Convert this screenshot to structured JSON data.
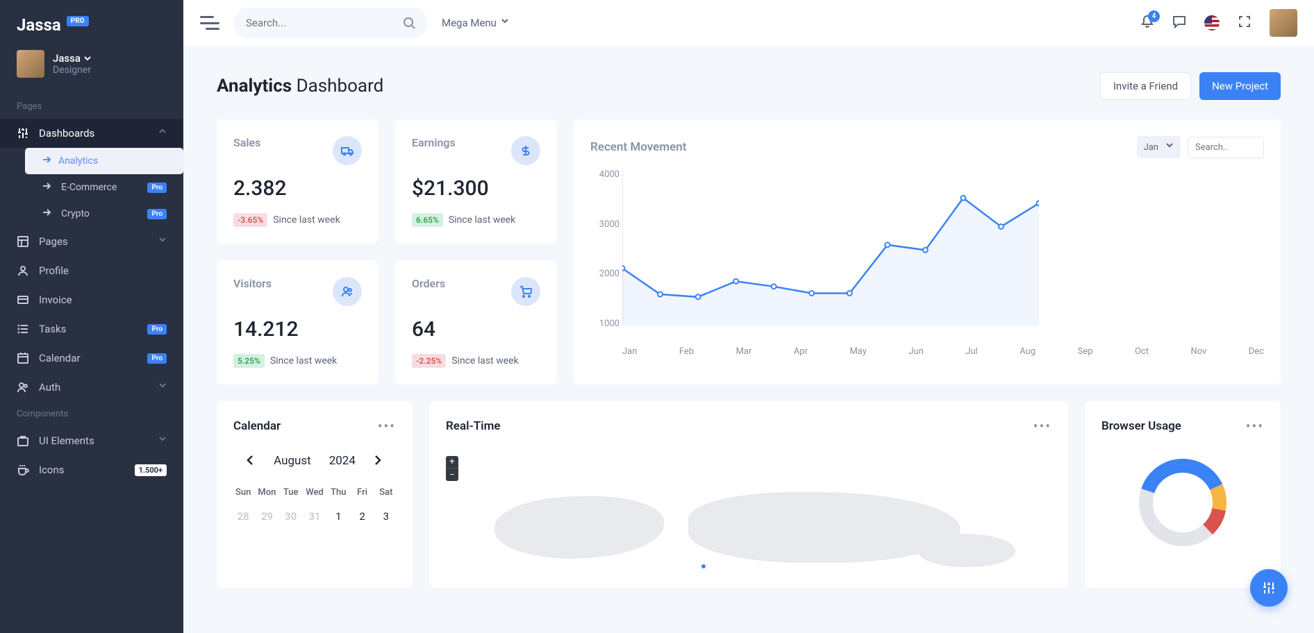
{
  "brand": {
    "name": "Jassa",
    "badge": "PRO"
  },
  "user": {
    "name": "Jassa",
    "role": "Designer"
  },
  "nav": {
    "heading1": "Pages",
    "heading2": "Components",
    "dashboards": "Dashboards",
    "analytics": "Analytics",
    "ecommerce": "E-Commerce",
    "crypto": "Crypto",
    "pages": "Pages",
    "profile": "Profile",
    "invoice": "Invoice",
    "tasks": "Tasks",
    "calendar": "Calendar",
    "auth": "Auth",
    "ui": "UI Elements",
    "icons": "Icons",
    "pro": "Pro",
    "icons_count": "1.500+"
  },
  "topbar": {
    "search_ph": "Search...",
    "mega": "Mega Menu",
    "notif": "4"
  },
  "page": {
    "title_bold": "Analytics",
    "title_rest": "Dashboard",
    "invite": "Invite a Friend",
    "new": "New Project"
  },
  "stats": {
    "since": "Since last week",
    "sales": {
      "label": "Sales",
      "value": "2.382",
      "pct": "-3.65%"
    },
    "earnings": {
      "label": "Earnings",
      "value": "$21.300",
      "pct": "6.65%"
    },
    "visitors": {
      "label": "Visitors",
      "value": "14.212",
      "pct": "5.25%"
    },
    "orders": {
      "label": "Orders",
      "value": "64",
      "pct": "-2.25%"
    }
  },
  "chart": {
    "title": "Recent Movement",
    "period": "Jan",
    "search_ph": "Search.."
  },
  "chart_data": {
    "type": "line",
    "title": "Recent Movement",
    "xlabel": "",
    "ylabel": "",
    "ylim": [
      1000,
      4000
    ],
    "y_ticks": [
      "4000",
      "3000",
      "2000",
      "1000"
    ],
    "categories": [
      "Jan",
      "Feb",
      "Mar",
      "Apr",
      "May",
      "Jun",
      "Jul",
      "Aug",
      "Sep",
      "Oct",
      "Nov",
      "Dec"
    ],
    "values": [
      2100,
      1600,
      1550,
      1850,
      1750,
      1620,
      1620,
      2550,
      2450,
      3450,
      2900,
      3350
    ]
  },
  "calendar": {
    "title": "Calendar",
    "month": "August",
    "year": "2024",
    "dow": [
      "Sun",
      "Mon",
      "Tue",
      "Wed",
      "Thu",
      "Fri",
      "Sat"
    ],
    "row1": [
      "28",
      "29",
      "30",
      "31",
      "1",
      "2",
      "3"
    ]
  },
  "realtime": {
    "title": "Real-Time"
  },
  "browser": {
    "title": "Browser Usage"
  }
}
